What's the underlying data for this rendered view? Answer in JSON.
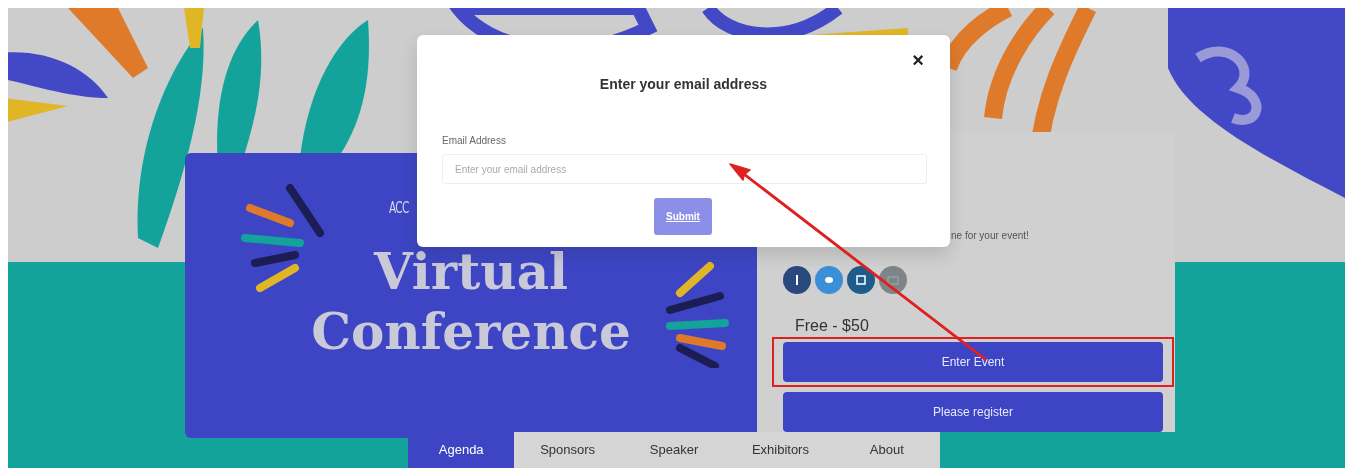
{
  "banner": {
    "eyebrow": "ACC",
    "title_lines": [
      "Virtual",
      "Conference"
    ]
  },
  "event_panel": {
    "description": "ne for your event!",
    "social_links": [
      {
        "kind": "facebook"
      },
      {
        "kind": "twitter"
      },
      {
        "kind": "linkedin"
      },
      {
        "kind": "email"
      }
    ],
    "price": "Free - $50",
    "buttons": [
      {
        "label": "Enter Event",
        "highlighted": true
      },
      {
        "label": "Please register",
        "highlighted": false
      }
    ]
  },
  "tabs": [
    {
      "label": "Agenda",
      "selected": true
    },
    {
      "label": "Sponsors",
      "selected": false
    },
    {
      "label": "Speaker",
      "selected": false
    },
    {
      "label": "Exhibitors",
      "selected": false
    },
    {
      "label": "About",
      "selected": false
    }
  ],
  "modal": {
    "title": "Enter your email address",
    "close": "×",
    "email_label": "Email Address",
    "email_placeholder": "Enter your email address",
    "submit": "Submit"
  }
}
